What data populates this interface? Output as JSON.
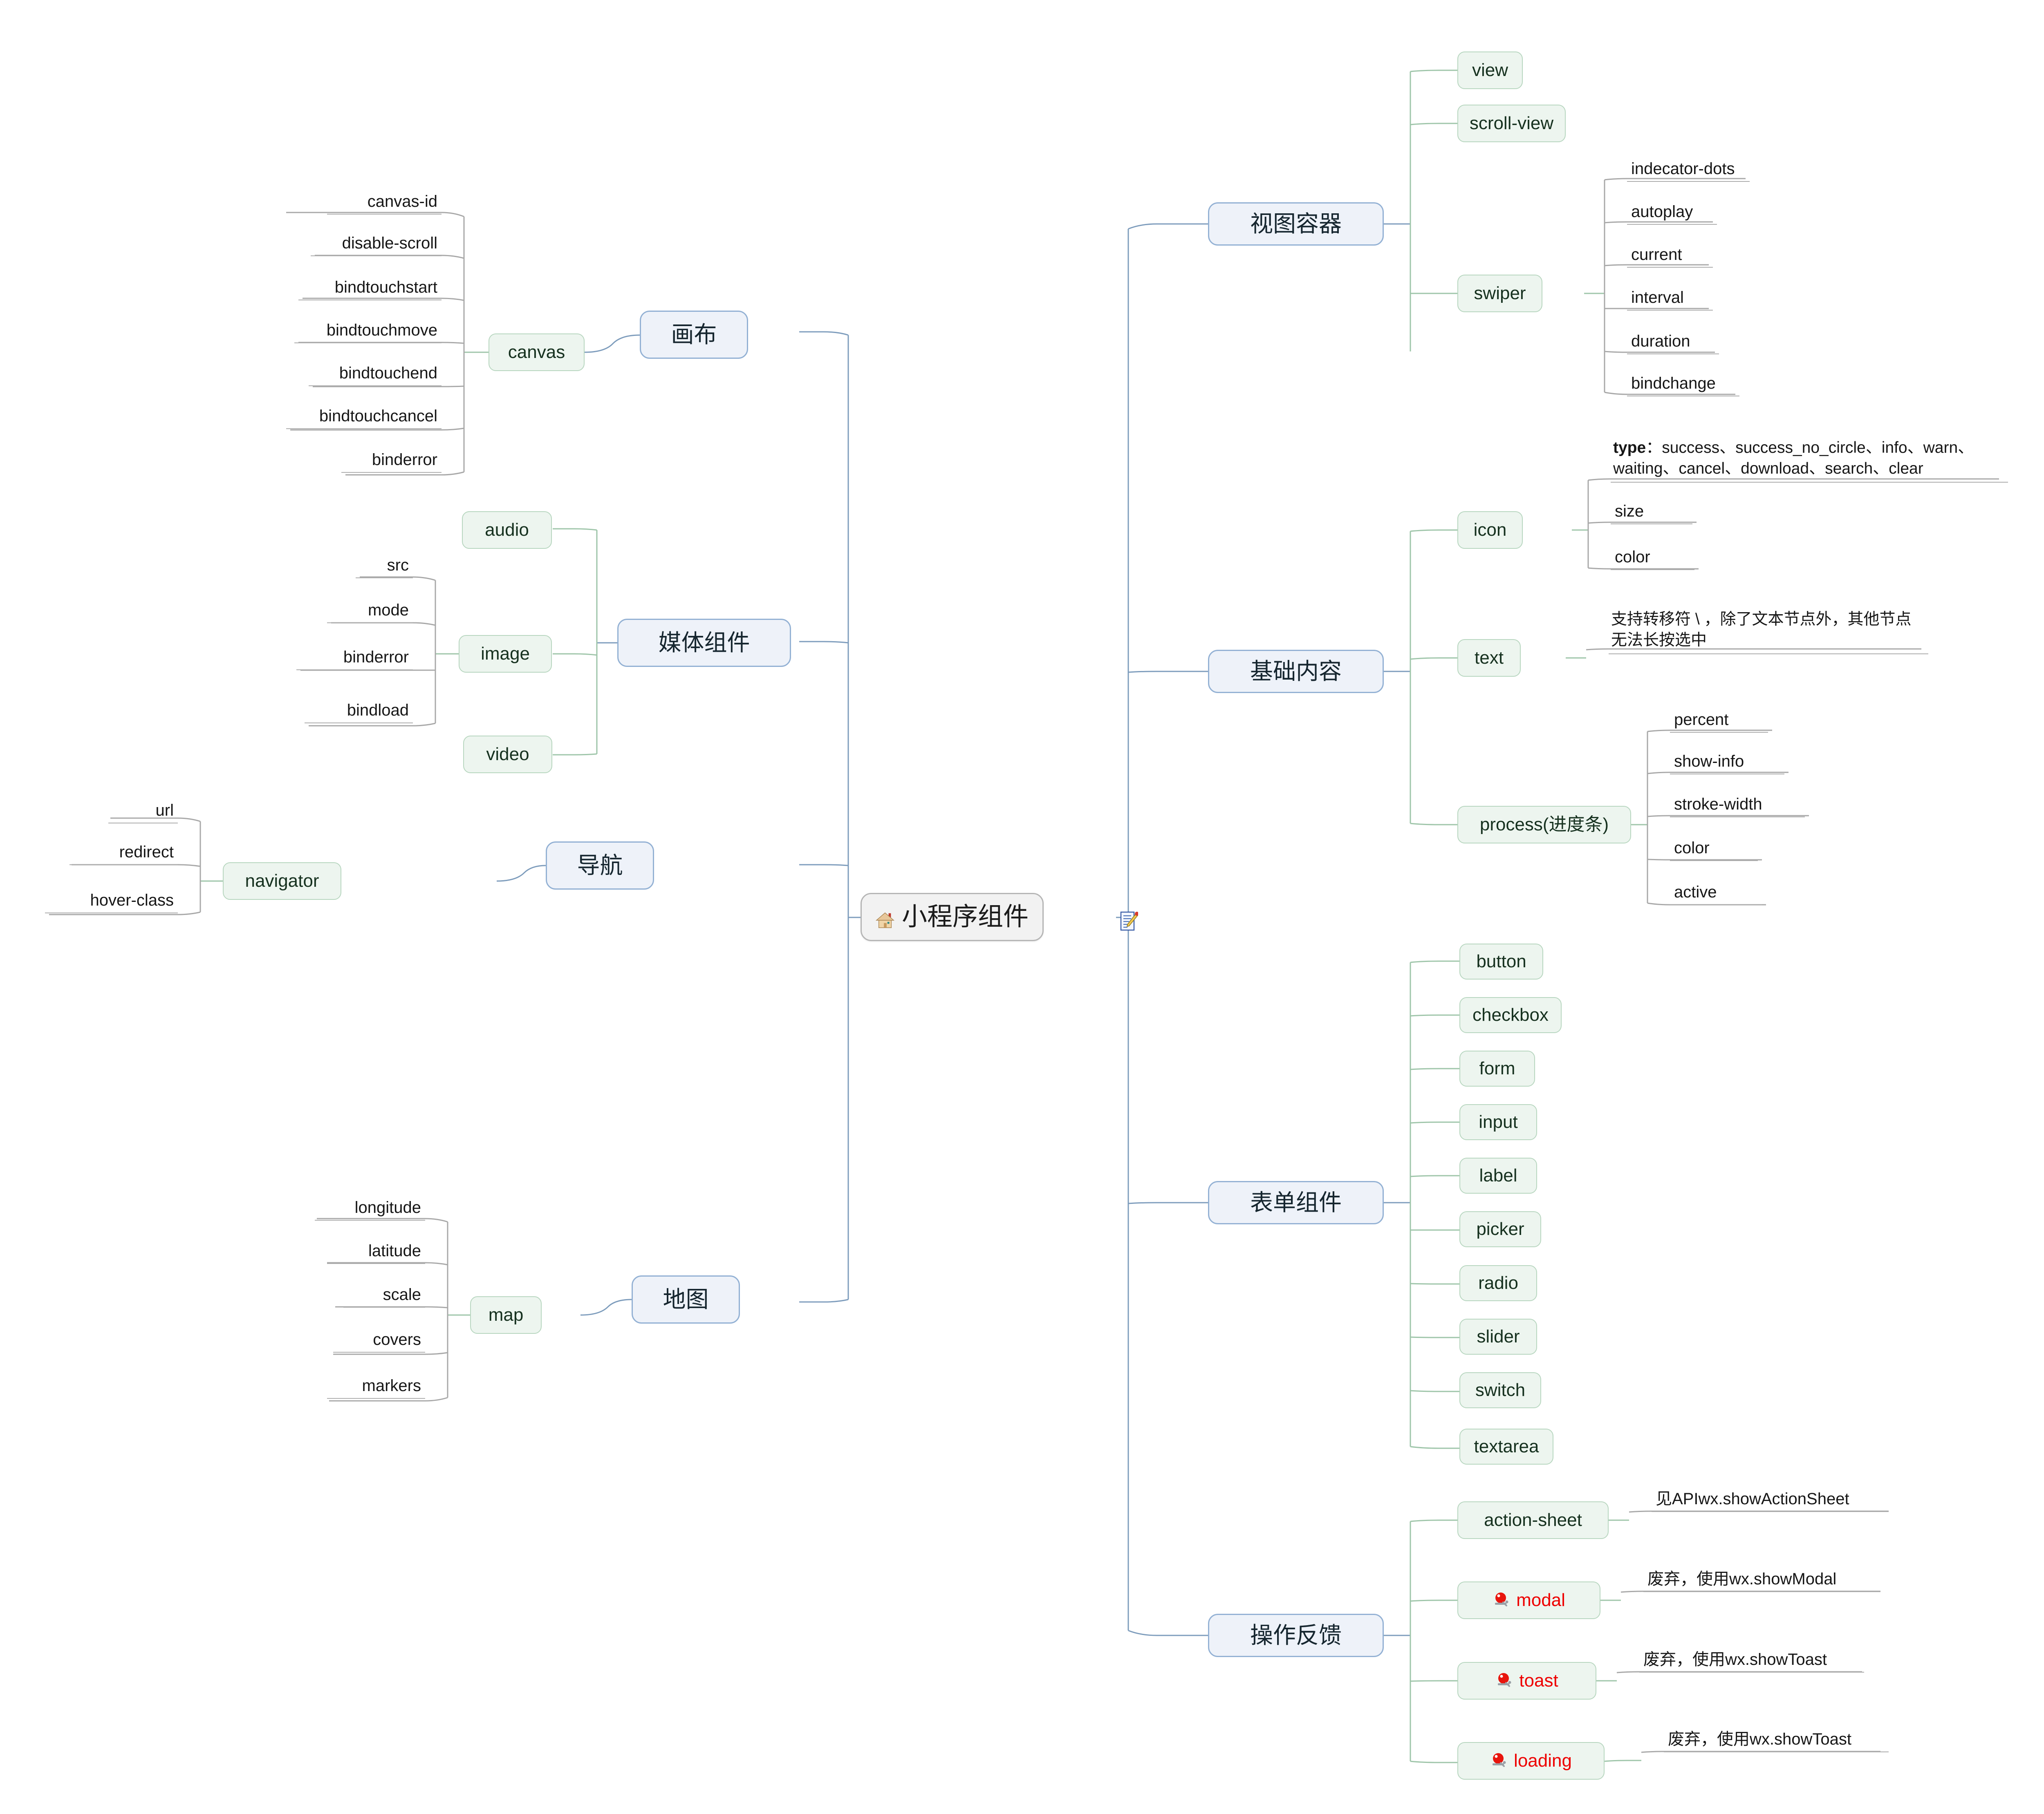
{
  "root": {
    "label": "小程序组件",
    "home_icon": "home-icon",
    "edit_note_icon": "note-edit-icon"
  },
  "colors": {
    "main_fill": "#eef2f9",
    "main_border": "#93b1d4",
    "sub_fill": "#edf5ef",
    "sub_border": "#b7d6bf",
    "root_fill": "#f2f2f2",
    "root_border": "#b5b5b5",
    "leaf_underline": "#adadad",
    "wire_blue": "#7d9cbc",
    "wire_green": "#9ec5a9",
    "wire_gray": "#a8a8a8",
    "deprecated_text": "#ee0000"
  },
  "branches_right": [
    {
      "label": "视图容器",
      "children": [
        {
          "label": "view",
          "children": []
        },
        {
          "label": "scroll-view",
          "children": []
        },
        {
          "label": "swiper",
          "children": [
            {
              "label": "indecator-dots"
            },
            {
              "label": "autoplay"
            },
            {
              "label": "current"
            },
            {
              "label": "interval"
            },
            {
              "label": "duration"
            },
            {
              "label": "bindchange"
            }
          ]
        }
      ]
    },
    {
      "label": "基础内容",
      "children": [
        {
          "label": "icon",
          "children": [
            {
              "label": "type：success、success_no_circle、info、warn、waiting、cancel、download、search、clear",
              "bold_prefix": "type"
            },
            {
              "label": "size"
            },
            {
              "label": "color"
            }
          ]
        },
        {
          "label": "text",
          "children": [
            {
              "label": "支持转移符 \\ ，除了文本节点外，其他节点无法长按选中"
            }
          ]
        },
        {
          "label": "process(进度条)",
          "children": [
            {
              "label": "percent"
            },
            {
              "label": "show-info"
            },
            {
              "label": "stroke-width"
            },
            {
              "label": "color"
            },
            {
              "label": "active"
            }
          ]
        }
      ]
    },
    {
      "label": "表单组件",
      "children": [
        {
          "label": "button",
          "children": []
        },
        {
          "label": "checkbox",
          "children": []
        },
        {
          "label": "form",
          "children": []
        },
        {
          "label": "input",
          "children": []
        },
        {
          "label": "label",
          "children": []
        },
        {
          "label": "picker",
          "children": []
        },
        {
          "label": "radio",
          "children": []
        },
        {
          "label": "slider",
          "children": []
        },
        {
          "label": "switch",
          "children": []
        },
        {
          "label": "textarea",
          "children": []
        }
      ]
    },
    {
      "label": "操作反馈",
      "children": [
        {
          "label": "action-sheet",
          "icon": null,
          "deprecated": false,
          "children": [
            {
              "label": "见APIwx.showActionSheet"
            }
          ]
        },
        {
          "label": "modal",
          "icon": "alarm-bell-icon",
          "deprecated": true,
          "children": [
            {
              "label": "废弃，使用wx.showModal"
            }
          ]
        },
        {
          "label": "toast",
          "icon": "alarm-bell-icon",
          "deprecated": true,
          "children": [
            {
              "label": "废弃，使用wx.showToast"
            }
          ]
        },
        {
          "label": "loading",
          "icon": "alarm-bell-icon",
          "deprecated": true,
          "children": [
            {
              "label": "废弃，使用wx.showToast"
            }
          ]
        }
      ]
    }
  ],
  "branches_left": [
    {
      "label": "画布",
      "children": [
        {
          "label": "canvas",
          "children": [
            {
              "label": "canvas-id"
            },
            {
              "label": "disable-scroll"
            },
            {
              "label": "bindtouchstart"
            },
            {
              "label": "bindtouchmove"
            },
            {
              "label": "bindtouchend"
            },
            {
              "label": "bindtouchcancel"
            },
            {
              "label": "binderror"
            }
          ]
        }
      ]
    },
    {
      "label": "媒体组件",
      "children": [
        {
          "label": "audio",
          "children": []
        },
        {
          "label": "image",
          "children": [
            {
              "label": "src"
            },
            {
              "label": "mode"
            },
            {
              "label": "binderror"
            },
            {
              "label": "bindload"
            }
          ]
        },
        {
          "label": "video",
          "children": []
        }
      ]
    },
    {
      "label": "导航",
      "children": [
        {
          "label": "navigator",
          "children": [
            {
              "label": "url"
            },
            {
              "label": "redirect"
            },
            {
              "label": "hover-class"
            }
          ]
        }
      ]
    },
    {
      "label": "地图",
      "children": [
        {
          "label": "map",
          "children": [
            {
              "label": "longitude"
            },
            {
              "label": "latitude"
            },
            {
              "label": "scale"
            },
            {
              "label": "covers"
            },
            {
              "label": "markers"
            }
          ]
        }
      ]
    }
  ]
}
